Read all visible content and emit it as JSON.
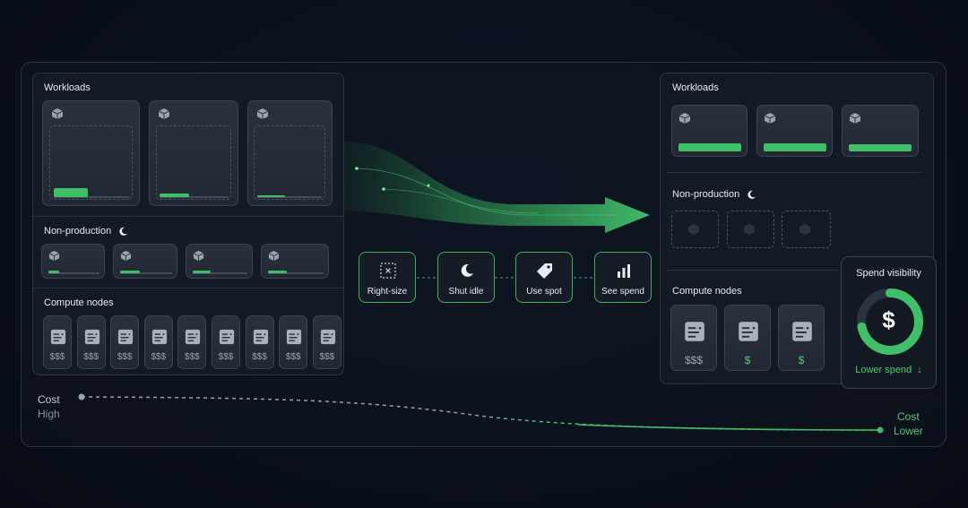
{
  "before": {
    "workloads_title": "Workloads",
    "nonprod_title": "Non-production",
    "nodes_title": "Compute nodes",
    "node_costs": [
      "$$$",
      "$$$",
      "$$$",
      "$$$",
      "$$$",
      "$$$",
      "$$$",
      "$$$",
      "$$$"
    ]
  },
  "actions": [
    {
      "label": "Right-size",
      "icon": "resize-icon"
    },
    {
      "label": "Shut idle",
      "icon": "moon-icon"
    },
    {
      "label": "Use spot",
      "icon": "tag-icon"
    },
    {
      "label": "See spend",
      "icon": "bar-chart-icon"
    }
  ],
  "after": {
    "workloads_title": "Workloads",
    "nonprod_title": "Non-production",
    "nodes_title": "Compute nodes",
    "node_costs": [
      "$$$",
      "$",
      "$"
    ]
  },
  "spend": {
    "title": "Spend visibility",
    "symbol": "$",
    "footer": "Lower spend",
    "level": 0.72
  },
  "cost": {
    "start_line1": "Cost",
    "start_line2": "High",
    "end_line1": "Cost",
    "end_line2": "Lower"
  },
  "colors": {
    "accent": "#3fbf68",
    "panel_bg": "#161c27",
    "background": "#0a101b"
  }
}
